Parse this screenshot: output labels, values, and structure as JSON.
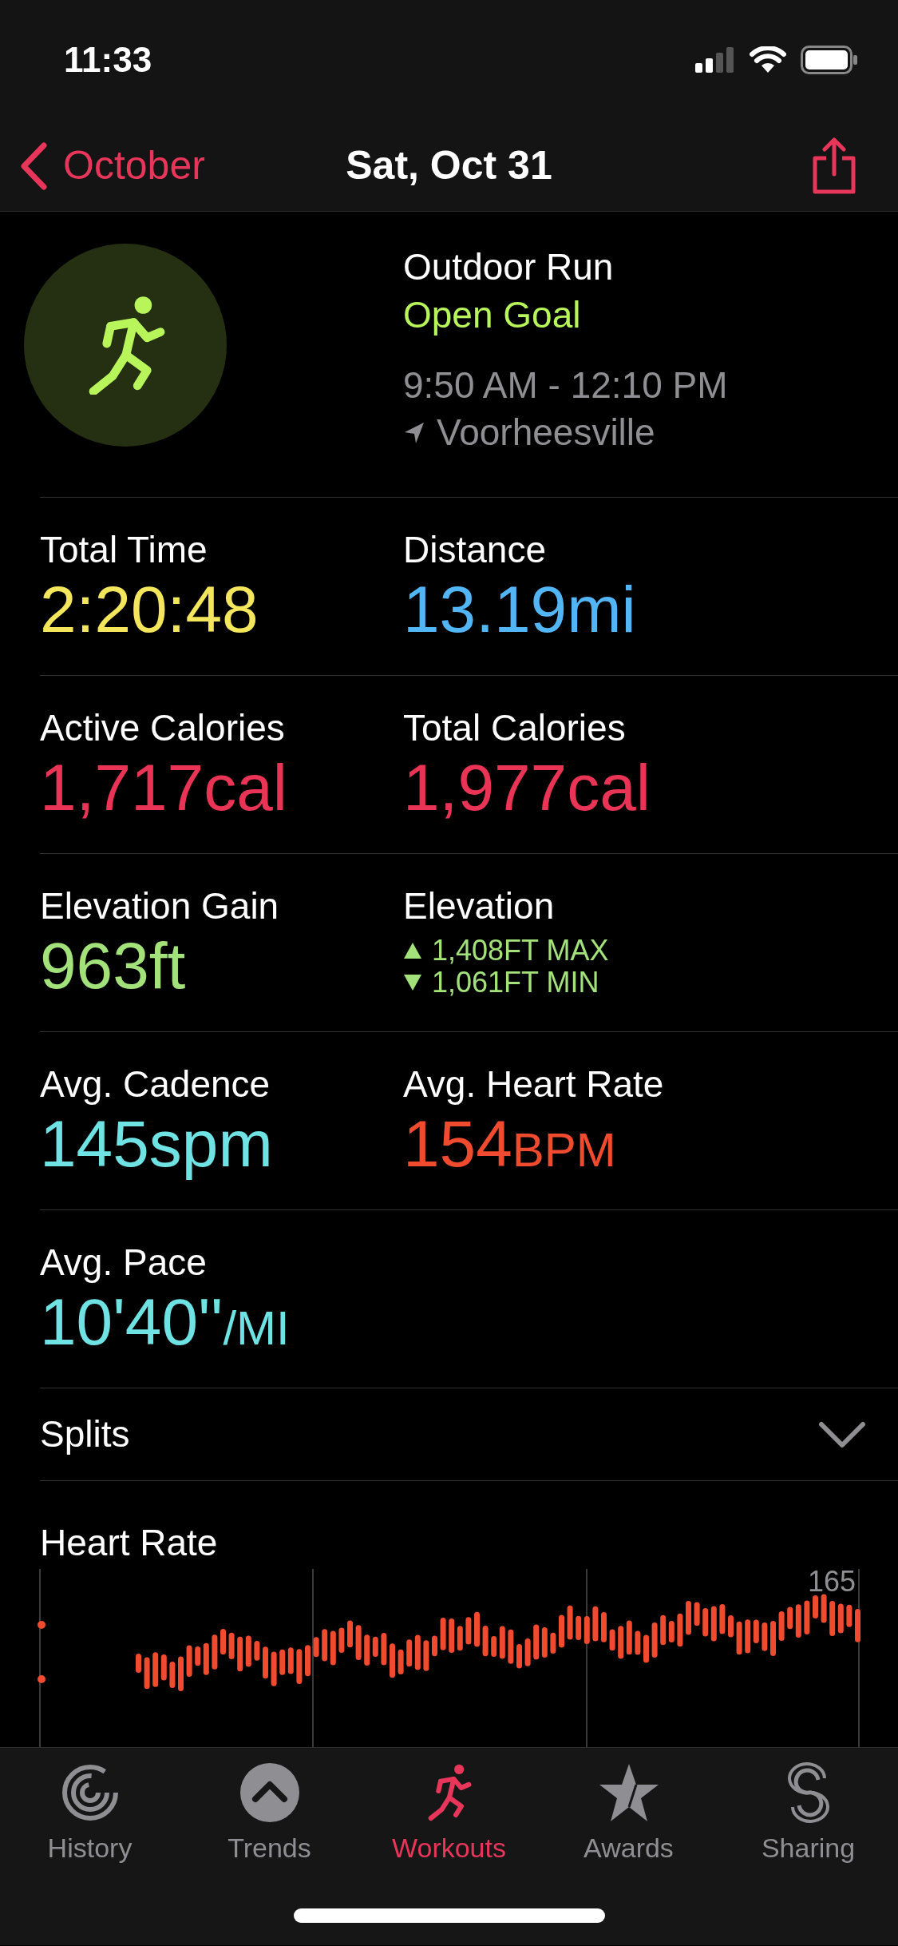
{
  "status_bar": {
    "time": "11:33"
  },
  "nav": {
    "back": "October",
    "title": "Sat, Oct 31"
  },
  "workout": {
    "type": "Outdoor Run",
    "goal": "Open Goal",
    "time_range": "9:50 AM - 12:10 PM",
    "location": "Voorheesville"
  },
  "metric_rows": [
    [
      {
        "kind": "value",
        "label": "Total Time",
        "value": "2:20:48",
        "color": "#f3e55c"
      },
      {
        "kind": "value",
        "label": "Distance",
        "value": "13.19mi",
        "color": "#52b6f6"
      }
    ],
    [
      {
        "kind": "value",
        "label": "Active Calories",
        "value": "1,717cal",
        "color": "#ea3456"
      },
      {
        "kind": "value",
        "label": "Total Calories",
        "value": "1,977cal",
        "color": "#ea3456"
      }
    ],
    [
      {
        "kind": "value",
        "label": "Elevation Gain",
        "value": "963ft",
        "color": "#a3e27a"
      },
      {
        "kind": "range",
        "label": "Elevation",
        "color": "#a3e27a",
        "lines": [
          {
            "kind": "max",
            "text": "1,408FT MAX"
          },
          {
            "kind": "min",
            "text": "1,061FT MIN"
          }
        ]
      }
    ],
    [
      {
        "kind": "value",
        "label": "Avg. Cadence",
        "value": "145spm",
        "color": "#6fe3e4"
      },
      {
        "kind": "value_unit",
        "label": "Avg. Heart Rate",
        "value": "154",
        "unit": "BPM",
        "color": "#f04a2f"
      }
    ],
    [
      {
        "kind": "value_unit",
        "label": "Avg. Pace",
        "value": "10'40''",
        "unit": "/MI",
        "color": "#6fe3e4"
      }
    ]
  ],
  "splits": {
    "label": "Splits",
    "expanded": false
  },
  "heart_rate": {
    "title": "Heart Rate",
    "axis_label": "165"
  },
  "tabs": [
    {
      "label": "History",
      "selected": false
    },
    {
      "label": "Trends",
      "selected": false
    },
    {
      "label": "Workouts",
      "selected": true
    },
    {
      "label": "Awards",
      "selected": false
    },
    {
      "label": "Sharing",
      "selected": false
    }
  ]
}
